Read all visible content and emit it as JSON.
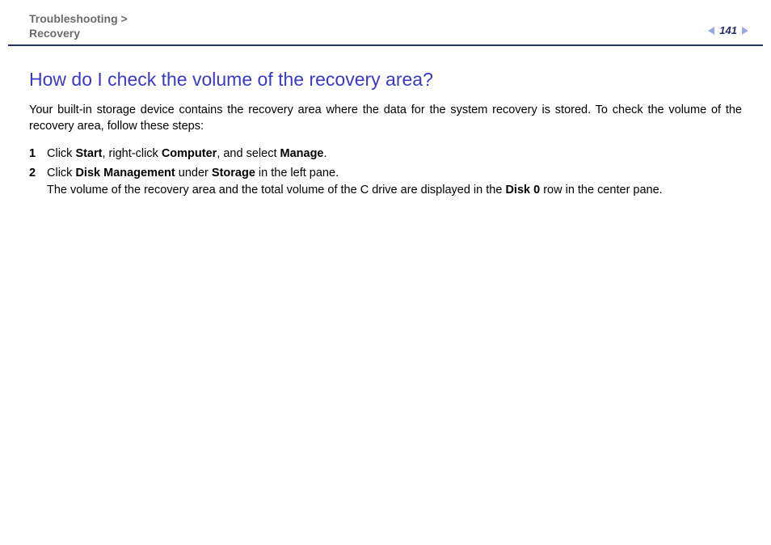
{
  "header": {
    "breadcrumb_section": "Troubleshooting",
    "breadcrumb_sep": " >",
    "breadcrumb_sub": "Recovery",
    "page_number": "141"
  },
  "content": {
    "title": "How do I check the volume of the recovery area?",
    "intro": "Your built-in storage device contains the recovery area where the data for the system recovery is stored. To check the volume of the recovery area, follow these steps:",
    "step1": {
      "t1": "Click ",
      "b1": "Start",
      "t2": ", right-click ",
      "b2": "Computer",
      "t3": ", and select ",
      "b3": "Manage",
      "t4": "."
    },
    "step2": {
      "t1": "Click ",
      "b1": "Disk Management",
      "t2": " under ",
      "b2": "Storage",
      "t3": " in the left pane.",
      "line2a": "The volume of the recovery area and the total volume of the C drive are displayed in the ",
      "line2b": "Disk 0",
      "line2c": " row in the center pane."
    }
  }
}
